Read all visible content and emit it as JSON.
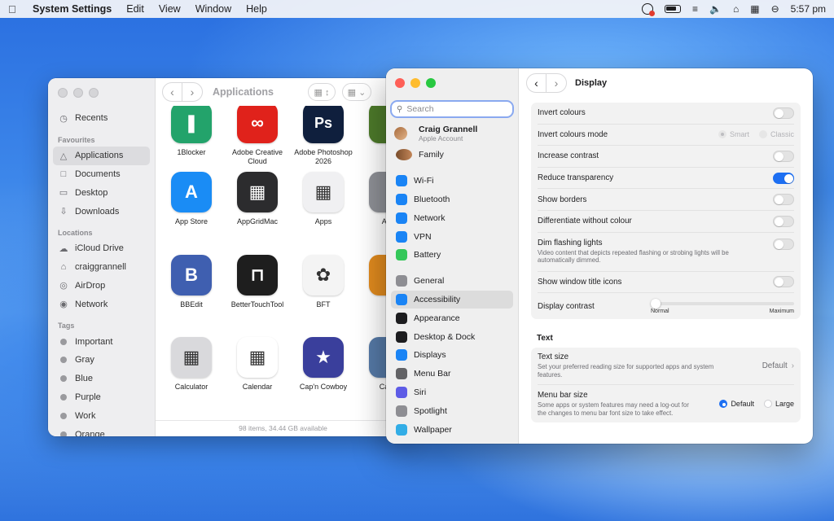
{
  "menubar": {
    "app_name": "System Settings",
    "menus": [
      "Edit",
      "View",
      "Window",
      "Help"
    ],
    "time": "5:57 pm"
  },
  "finder": {
    "title": "Applications",
    "status": "98 items, 34.44 GB available",
    "sidebar": {
      "recents": "Recents",
      "favourites_header": "Favourites",
      "favourites": [
        "Applications",
        "Documents",
        "Desktop",
        "Downloads"
      ],
      "locations_header": "Locations",
      "locations": [
        "iCloud Drive",
        "craiggrannell",
        "AirDrop",
        "Network"
      ],
      "tags_header": "Tags",
      "tags": [
        "Important",
        "Gray",
        "Blue",
        "Purple",
        "Work",
        "Orange"
      ]
    },
    "apps": [
      {
        "name": "1Blocker",
        "color": "#23a36b",
        "glyph": "❚"
      },
      {
        "name": "Adobe Creative Cloud",
        "color": "#e0221b",
        "glyph": "∞"
      },
      {
        "name": "Adobe Photoshop 2026",
        "color": "#0f1f3d",
        "glyph": "Ps"
      },
      {
        "name": "A",
        "color": "#4d7a2a",
        "glyph": ""
      },
      {
        "name": "App Store",
        "color": "#1a8cf5",
        "glyph": "A"
      },
      {
        "name": "AppGridMac",
        "color": "#2c2c2e",
        "glyph": "▦"
      },
      {
        "name": "Apps",
        "color": "#f0f0f2",
        "glyph": "▦"
      },
      {
        "name": "Auto",
        "color": "#8e9096",
        "glyph": ""
      },
      {
        "name": "BBEdit",
        "color": "#3f5fb0",
        "glyph": "B"
      },
      {
        "name": "BetterTouchTool",
        "color": "#1e1e1e",
        "glyph": "⊓"
      },
      {
        "name": "BFT",
        "color": "#f4f4f4",
        "glyph": "✿"
      },
      {
        "name": "B",
        "color": "#e08a1e",
        "glyph": ""
      },
      {
        "name": "Calculator",
        "color": "#d9d9dc",
        "glyph": "▦"
      },
      {
        "name": "Calendar",
        "color": "#ffffff",
        "glyph": "▦"
      },
      {
        "name": "Cap'n Cowboy",
        "color": "#3a3f9c",
        "glyph": "★"
      },
      {
        "name": "Carbo",
        "color": "#5579a6",
        "glyph": ""
      }
    ]
  },
  "settings": {
    "search_placeholder": "Search",
    "account_name": "Craig Grannell",
    "account_sub": "Apple Account",
    "family": "Family",
    "sidebar_group1": [
      {
        "label": "Wi-Fi",
        "color": "#1a84f5",
        "icon": "wifi-icon"
      },
      {
        "label": "Bluetooth",
        "color": "#1a84f5",
        "icon": "bluetooth-icon"
      },
      {
        "label": "Network",
        "color": "#1a84f5",
        "icon": "globe-icon"
      },
      {
        "label": "VPN",
        "color": "#1a84f5",
        "icon": "vpn-icon"
      },
      {
        "label": "Battery",
        "color": "#34c759",
        "icon": "battery-icon"
      }
    ],
    "sidebar_group2": [
      {
        "label": "General",
        "color": "#8e8e93",
        "icon": "gear-icon"
      },
      {
        "label": "Accessibility",
        "color": "#1a84f5",
        "icon": "accessibility-icon"
      },
      {
        "label": "Appearance",
        "color": "#1d1d1f",
        "icon": "appearance-icon"
      },
      {
        "label": "Desktop & Dock",
        "color": "#1d1d1f",
        "icon": "dock-icon"
      },
      {
        "label": "Displays",
        "color": "#1a84f5",
        "icon": "displays-icon"
      },
      {
        "label": "Menu Bar",
        "color": "#636366",
        "icon": "menubar-icon"
      },
      {
        "label": "Siri",
        "color": "#5e5ce6",
        "icon": "siri-icon"
      },
      {
        "label": "Spotlight",
        "color": "#8e8e93",
        "icon": "spotlight-icon"
      },
      {
        "label": "Wallpaper",
        "color": "#32ade6",
        "icon": "wallpaper-icon"
      }
    ],
    "selected_sidebar": "Accessibility",
    "page_title": "Display",
    "display": {
      "invert_colours": "Invert colours",
      "invert_mode": "Invert colours mode",
      "invert_mode_smart": "Smart",
      "invert_mode_classic": "Classic",
      "increase_contrast": "Increase contrast",
      "reduce_transparency": "Reduce transparency",
      "show_borders": "Show borders",
      "differentiate": "Differentiate without colour",
      "dim_flashing": "Dim flashing lights",
      "dim_flashing_sub": "Video content that depicts repeated flashing or strobing lights will be automatically dimmed.",
      "show_window_title_icons": "Show window title icons",
      "display_contrast": "Display contrast",
      "contrast_min": "Normal",
      "contrast_max": "Maximum",
      "contrast_value": 0
    },
    "text_section": "Text",
    "text": {
      "text_size": "Text size",
      "text_size_sub": "Set your preferred reading size for supported apps and system features.",
      "text_size_value": "Default",
      "menu_bar_size": "Menu bar size",
      "menu_bar_size_sub": "Some apps or system features may need a log-out for the changes to menu bar font size to take effect.",
      "menu_bar_default": "Default",
      "menu_bar_large": "Large"
    }
  }
}
